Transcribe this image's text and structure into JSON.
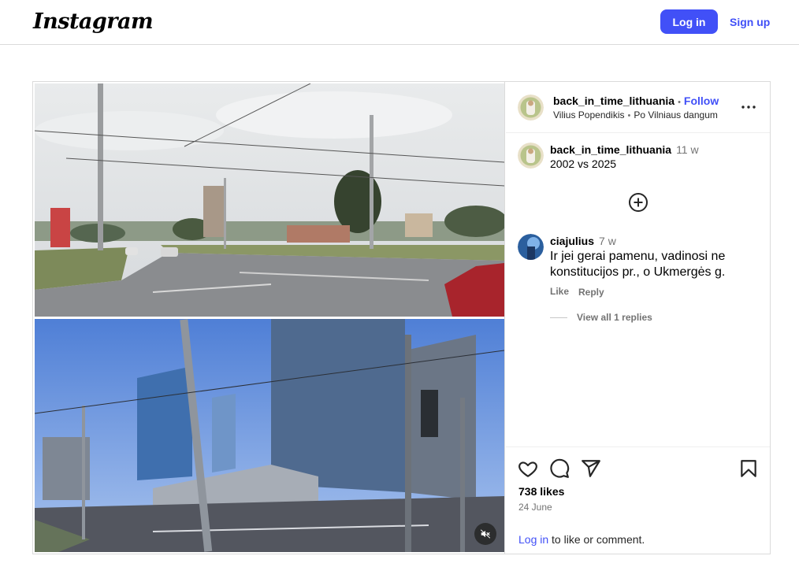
{
  "header": {
    "logo_text": "Instagram",
    "login_label": "Log in",
    "signup_label": "Sign up"
  },
  "post": {
    "author": "back_in_time_lithuania",
    "follow_label": "Follow",
    "audio_artist": "Vilius Popendikis",
    "audio_title": "Po Vilniaus dangum",
    "caption": {
      "author": "back_in_time_lithuania",
      "time": "11 w",
      "text": "2002 vs 2025"
    },
    "comments": [
      {
        "author": "ciajulius",
        "time": "7 w",
        "text": "Ir jei gerai pamenu, vadinosi ne konstitucijos pr., o Ukmergės g.",
        "like_label": "Like",
        "reply_label": "Reply",
        "view_replies_label": "View all 1 replies"
      }
    ],
    "likes": "738 likes",
    "date": "24 June",
    "login_prompt": {
      "link": "Log in",
      "rest": " to like or comment."
    }
  },
  "icons": {
    "more": "more-options-icon",
    "add_comment": "add-circle-icon",
    "like": "heart-icon",
    "comment": "comment-icon",
    "share": "share-icon",
    "save": "bookmark-icon",
    "mute": "muted-speaker-icon"
  },
  "colors": {
    "accent": "#4150f7",
    "muted_text": "#737373",
    "border": "#dbdbdb"
  }
}
